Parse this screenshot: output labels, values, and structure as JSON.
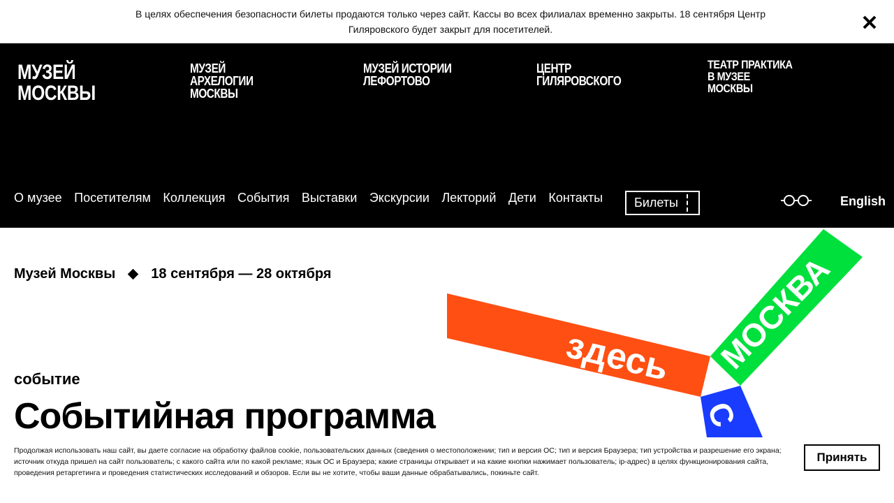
{
  "alert": {
    "text": "В целях обеспечения безопасности билеты продаются только через сайт. Кассы во всех филиалах временно закрыты. 18 сентября Центр Гиляровского будет закрыт для посетителей.",
    "close_icon": "close-icon"
  },
  "header": {
    "brand_main": "МУЗЕЙ МОСКВЫ",
    "branches": [
      "МУЗЕЙ АРХЕЛОГИИ МОСКВЫ",
      "МУЗЕЙ ИСТОРИИ ЛЕФОРТОВО",
      "ЦЕНТР ГИЛЯРОВСКОГО",
      "ТЕАТР ПРАКТИКА В МУЗЕЕ МОСКВЫ"
    ],
    "nav": [
      "О музее",
      "Посетителям",
      "Коллекция",
      "События",
      "Выставки",
      "Экскурсии",
      "Лекторий",
      "Дети",
      "Контакты"
    ],
    "tickets_label": "Билеты",
    "accessibility_icon": "glasses-icon",
    "language_label": "English"
  },
  "main": {
    "venue": "Музей Москвы",
    "dates": "18 сентября — 28 октября",
    "category": "событие",
    "title": "Событийная программа",
    "artwork": {
      "word_orange": "здесь",
      "word_green": "МОСКВА",
      "word_blue": "С",
      "colors": {
        "orange": "#ff4f12",
        "green": "#00e03c",
        "blue": "#1a3cff"
      }
    }
  },
  "cookie": {
    "text": "Продолжая использовать наш сайт, вы даете согласие на обработку файлов cookie, пользовательских данных (сведения о местоположении; тип и версия ОС; тип и версия Браузера; тип устройства и разрешение его экрана; источник откуда пришел на сайт пользователь; с какого сайта или по какой рекламе; язык ОС и Браузера; какие страницы открывает и на какие кнопки нажимает пользователь; ip-адрес) в целях функционирования сайта, проведения ретаргетинга и проведения статистических исследований и обзоров. Если вы не хотите, чтобы ваши данные обрабатывались, покиньте сайт.",
    "accept_label": "Принять"
  }
}
